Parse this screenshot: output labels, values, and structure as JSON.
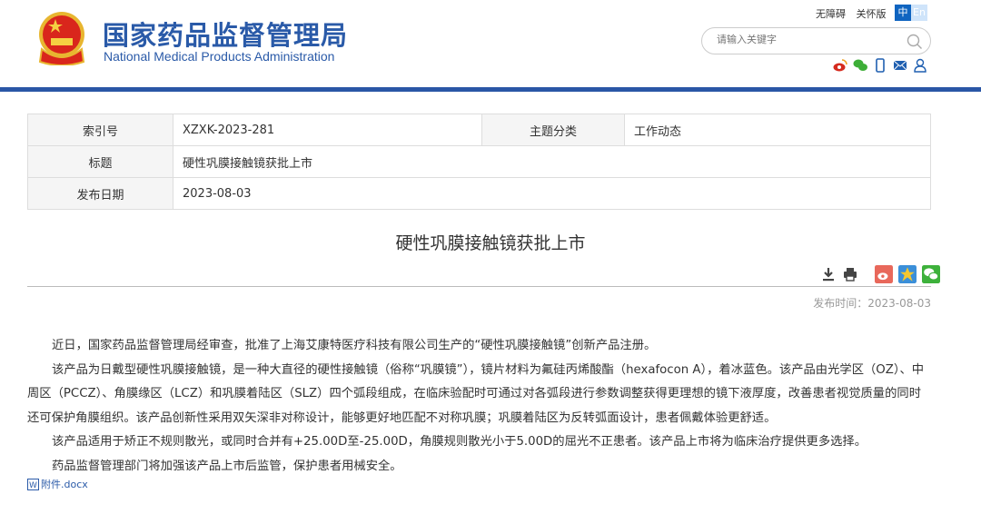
{
  "header": {
    "title_cn": "国家药品监督管理局",
    "title_en": "National Medical Products Administration",
    "links": [
      "无障碍",
      "关怀版"
    ],
    "lang": [
      "中",
      "En"
    ],
    "search_placeholder": "请输入关键字"
  },
  "meta": {
    "index_label": "索引号",
    "index_value": "XZXK-2023-281",
    "topic_label": "主题分类",
    "topic_value": "工作动态",
    "title_label": "标题",
    "title_value": "硬性巩膜接触镜获批上市",
    "date_label": "发布日期",
    "date_value": "2023-08-03"
  },
  "article": {
    "title": "硬性巩膜接触镜获批上市",
    "pubtime": "发布时间：2023-08-03",
    "paragraphs": [
      "近日，国家药品监督管理局经审查，批准了上海艾康特医疗科技有限公司生产的“硬性巩膜接触镜”创新产品注册。",
      "该产品为日戴型硬性巩膜接触镜，是一种大直径的硬性接触镜（俗称“巩膜镜”），镜片材料为氟硅丙烯酸酯（hexafocon A），着冰蓝色。该产品由光学区（OZ）、中周区（PCCZ）、角膜缘区（LCZ）和巩膜着陆区（SLZ）四个弧段组成，在临床验配时可通过对各弧段进行参数调整获得更理想的镜下液厚度，改善患者视觉质量的同时还可保护角膜组织。该产品创新性采用双矢深非对称设计，能够更好地匹配不对称巩膜；巩膜着陆区为反转弧面设计，患者佩戴体验更舒适。",
      "该产品适用于矫正不规则散光，或同时合并有+25.00D至-25.00D，角膜规则散光小于5.00D的屈光不正患者。该产品上市将为临床治疗提供更多选择。",
      "药品监督管理部门将加强该产品上市后监管，保护患者用械安全。"
    ],
    "attachment": "附件.docx"
  }
}
